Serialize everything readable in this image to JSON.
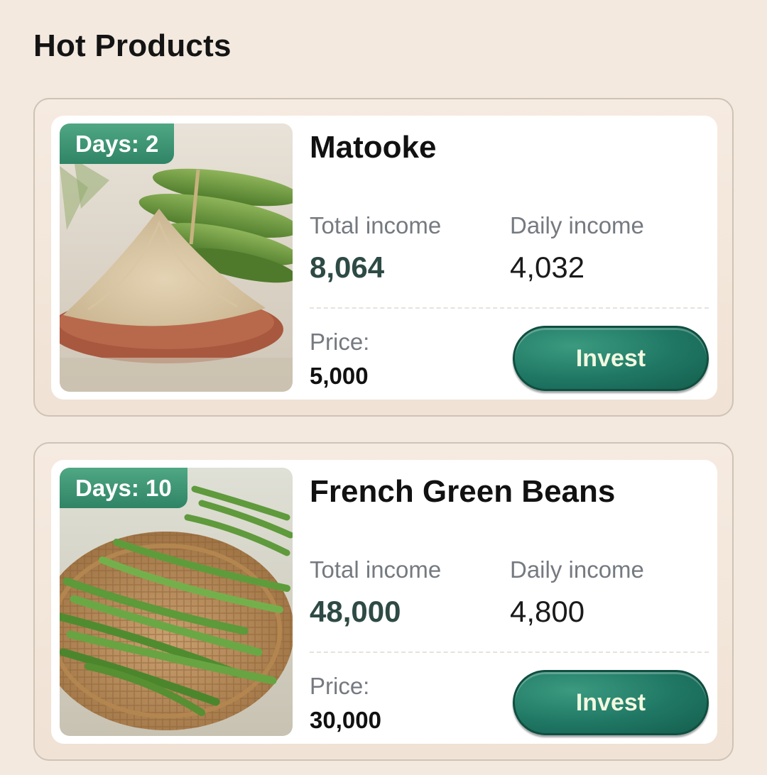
{
  "section": {
    "title": "Hot Products"
  },
  "products": [
    {
      "days": "Days: 2",
      "name": "Matooke",
      "total_label": "Total income",
      "total_value": "8,064",
      "daily_label": "Daily income",
      "daily_value": "4,032",
      "price_label": "Price:",
      "price_value": "5,000",
      "invest_label": "Invest",
      "image": "matooke-flour-image"
    },
    {
      "days": "Days: 10",
      "name": "French Green Beans",
      "total_label": "Total income",
      "total_value": "48,000",
      "daily_label": "Daily income",
      "daily_value": "4,800",
      "price_label": "Price:",
      "price_value": "30,000",
      "invest_label": "Invest",
      "image": "green-beans-image"
    }
  ],
  "colors": {
    "background": "#f3e9df",
    "accent_green": "#2f8465",
    "button_green": "#1f7763",
    "total_value_color": "#2e4a45"
  }
}
